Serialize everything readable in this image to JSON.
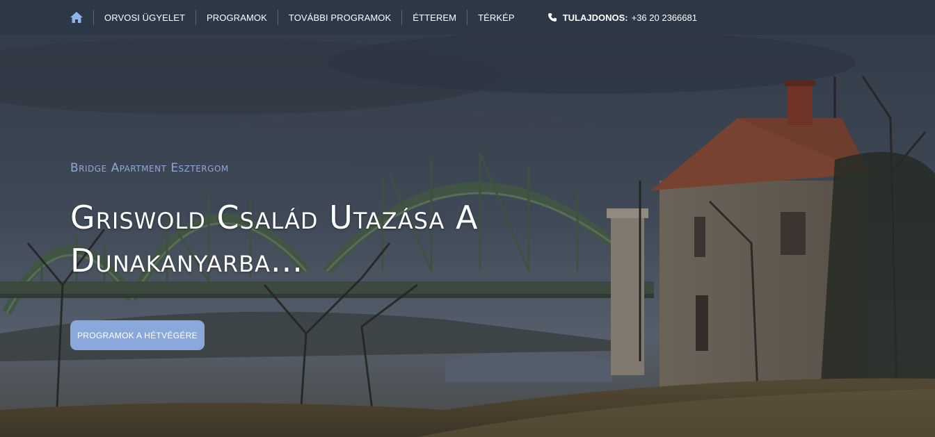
{
  "nav": {
    "home_icon": "home-icon",
    "items": [
      {
        "label": "ORVOSI ÜGYELET"
      },
      {
        "label": "PROGRAMOK"
      },
      {
        "label": "TOVÁBBI PROGRAMOK"
      },
      {
        "label": "ÉTTEREM"
      },
      {
        "label": "TÉRKÉP"
      }
    ],
    "phone": {
      "icon": "phone-icon",
      "label": "TULAJDONOS:",
      "number": "+36 20 2366681"
    }
  },
  "hero": {
    "subtitle": "Bridge Apartment Esztergom",
    "title": "Griswold Család Utazása A Dunakanyarba...",
    "cta_label": "PROGRAMOK A HÉTVÉGÉRE"
  },
  "colors": {
    "topbar": "#2c3846",
    "accent": "#8aa8dc",
    "home_icon": "#8fb2e8"
  }
}
